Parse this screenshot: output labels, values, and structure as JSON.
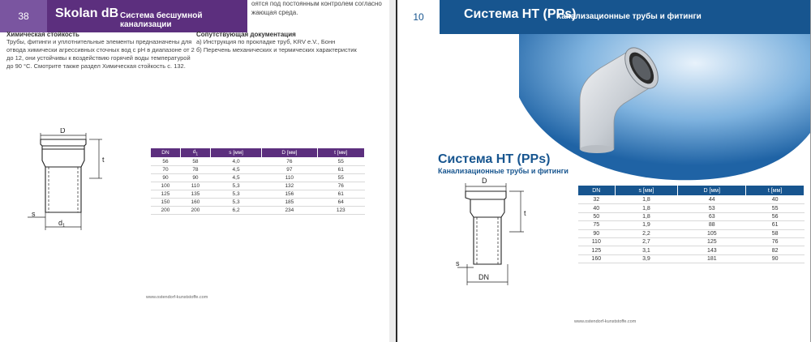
{
  "left_page": {
    "page_number": "38",
    "brand": "Skolan dB",
    "header_subtitle": "Система бесшумной канализации",
    "top_text_line1": "оятся под постоянным контролем согласно",
    "top_text_line2": "жающая среда.",
    "section1_title": "Химическая стойкость",
    "section1_lines": [
      "Трубы, фитинги и уплотнительные элементы предназначены для",
      "отвода химически агрессивных сточных вод с pH в диапазоне от 2",
      "до 12, они устойчивы к воздействию горячей воды температурой",
      "до 90 °C. Смотрите также раздел Химическая стойкость с. 132."
    ],
    "section2_title": "Сопутствующая документация",
    "section2_lines": [
      "а) Инструкция по прокладке труб, KRV e.V., Бонн",
      "б) Перечень механических и термических характеристик"
    ],
    "diagram": {
      "label_D": "D",
      "label_t": "t",
      "label_s": "s",
      "label_d": "d",
      "label_d_sub": "1"
    },
    "table": {
      "headers": [
        "DN",
        "d",
        "s [мм]",
        "D [мм]",
        "t [мм]"
      ],
      "header_d_sub": "1",
      "rows": [
        [
          "56",
          "58",
          "4,0",
          "76",
          "55"
        ],
        [
          "70",
          "78",
          "4,5",
          "97",
          "61"
        ],
        [
          "90",
          "90",
          "4,5",
          "110",
          "55"
        ],
        [
          "100",
          "110",
          "5,3",
          "132",
          "76"
        ],
        [
          "125",
          "135",
          "5,3",
          "156",
          "61"
        ],
        [
          "150",
          "160",
          "5,3",
          "185",
          "64"
        ],
        [
          "200",
          "200",
          "6,2",
          "234",
          "123"
        ]
      ]
    },
    "footer_url": "www.ostendorf-kunststoffe.com",
    "header_color": "#5c2f7e"
  },
  "right_page": {
    "page_number": "10",
    "header_title": "Система HT (PPs)",
    "header_subtitle": "Канализационные трубы и фитинги",
    "title": "Система HT (PPs)",
    "subtitle": "Канализационные трубы и фитинги",
    "product_image": "grey-45-degree-pipe-bend",
    "diagram": {
      "label_D": "D",
      "label_t": "t",
      "label_s": "s",
      "label_DN": "DN"
    },
    "table": {
      "headers": [
        "DN",
        "s [мм]",
        "D [мм]",
        "t [мм]"
      ],
      "rows": [
        [
          "32",
          "1,8",
          "44",
          "40"
        ],
        [
          "40",
          "1,8",
          "53",
          "55"
        ],
        [
          "50",
          "1,8",
          "63",
          "56"
        ],
        [
          "75",
          "1,9",
          "88",
          "61"
        ],
        [
          "90",
          "2,2",
          "105",
          "58"
        ],
        [
          "110",
          "2,7",
          "125",
          "76"
        ],
        [
          "125",
          "3,1",
          "143",
          "82"
        ],
        [
          "160",
          "3,9",
          "181",
          "90"
        ]
      ]
    },
    "footer_url": "www.ostendorf-kunststoffe.com",
    "header_color": "#17558f"
  }
}
